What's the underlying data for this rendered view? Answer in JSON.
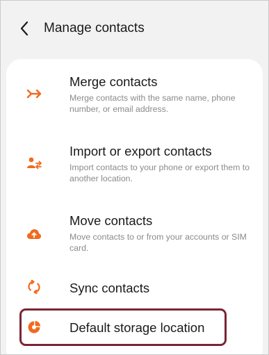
{
  "header": {
    "title": "Manage contacts",
    "back_icon": "chevron-left-icon"
  },
  "colors": {
    "accent": "#f06a1f",
    "highlight_border": "#7b2435",
    "background": "#f2f2f2",
    "card": "#ffffff"
  },
  "menu": {
    "items": [
      {
        "icon": "merge-icon",
        "title": "Merge contacts",
        "description": "Merge contacts with the same name, phone number, or email address."
      },
      {
        "icon": "import-export-icon",
        "title": "Import or export contacts",
        "description": "Import contacts to your phone or export them to another location."
      },
      {
        "icon": "cloud-upload-icon",
        "title": "Move contacts",
        "description": "Move contacts to or from your accounts or SIM card."
      },
      {
        "icon": "sync-icon",
        "title": "Sync contacts"
      },
      {
        "icon": "storage-pie-icon",
        "title": "Default storage location"
      }
    ]
  }
}
